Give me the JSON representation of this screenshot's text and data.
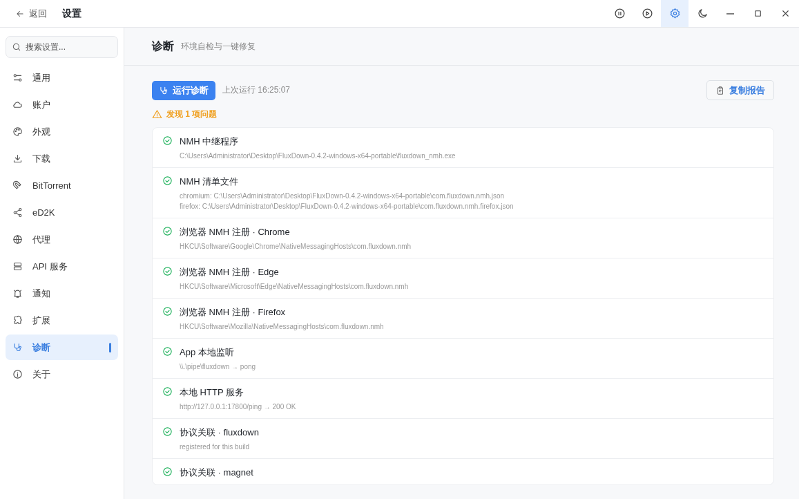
{
  "titlebar": {
    "back": "返回",
    "title": "设置",
    "tools": [
      {
        "selected": false
      },
      {
        "selected": false
      },
      {
        "selected": true
      },
      {
        "selected": false
      }
    ]
  },
  "sidebar": {
    "search": {
      "placeholder": "搜索设置..."
    },
    "items": [
      {
        "label": "通用",
        "selected": false
      },
      {
        "label": "账户",
        "selected": false
      },
      {
        "label": "外观",
        "selected": false
      },
      {
        "label": "下载",
        "selected": false
      },
      {
        "label": "BitTorrent",
        "selected": false
      },
      {
        "label": "eD2K",
        "selected": false
      },
      {
        "label": "代理",
        "selected": false
      },
      {
        "label": "API 服务",
        "selected": false
      },
      {
        "label": "通知",
        "selected": false
      },
      {
        "label": "扩展",
        "selected": false
      },
      {
        "label": "诊断",
        "selected": true
      },
      {
        "label": "关于",
        "selected": false
      }
    ]
  },
  "page": {
    "title": "诊断",
    "subtitle": "环境自检与一键修复",
    "run_button": "运行诊断",
    "last_run": "上次运行 16:25:07",
    "copy_button": "复制报告",
    "summary": "发现 1 项问题",
    "checks": [
      {
        "passed": true,
        "name": "NMH 中继程序",
        "details": [
          "C:\\Users\\Administrator\\Desktop\\FluxDown-0.4.2-windows-x64-portable\\fluxdown_nmh.exe"
        ]
      },
      {
        "passed": true,
        "name": "NMH 清单文件",
        "details": [
          "chromium: C:\\Users\\Administrator\\Desktop\\FluxDown-0.4.2-windows-x64-portable\\com.fluxdown.nmh.json",
          "firefox: C:\\Users\\Administrator\\Desktop\\FluxDown-0.4.2-windows-x64-portable\\com.fluxdown.nmh.firefox.json"
        ]
      },
      {
        "passed": true,
        "name": "浏览器 NMH 注册 · Chrome",
        "details": [
          "HKCU\\Software\\Google\\Chrome\\NativeMessagingHosts\\com.fluxdown.nmh"
        ]
      },
      {
        "passed": true,
        "name": "浏览器 NMH 注册 · Edge",
        "details": [
          "HKCU\\Software\\Microsoft\\Edge\\NativeMessagingHosts\\com.fluxdown.nmh"
        ]
      },
      {
        "passed": true,
        "name": "浏览器 NMH 注册 · Firefox",
        "details": [
          "HKCU\\Software\\Mozilla\\NativeMessagingHosts\\com.fluxdown.nmh"
        ]
      },
      {
        "passed": true,
        "name": "App 本地监听",
        "details": [
          "\\\\.\\pipe\\fluxdown → pong"
        ]
      },
      {
        "passed": true,
        "name": "本地 HTTP 服务",
        "details": [
          "http://127.0.0.1:17800/ping → 200 OK"
        ]
      },
      {
        "passed": true,
        "name": "协议关联 · fluxdown",
        "details": [
          "registered for this build"
        ]
      },
      {
        "passed": true,
        "name": "协议关联 · magnet"
      }
    ]
  }
}
